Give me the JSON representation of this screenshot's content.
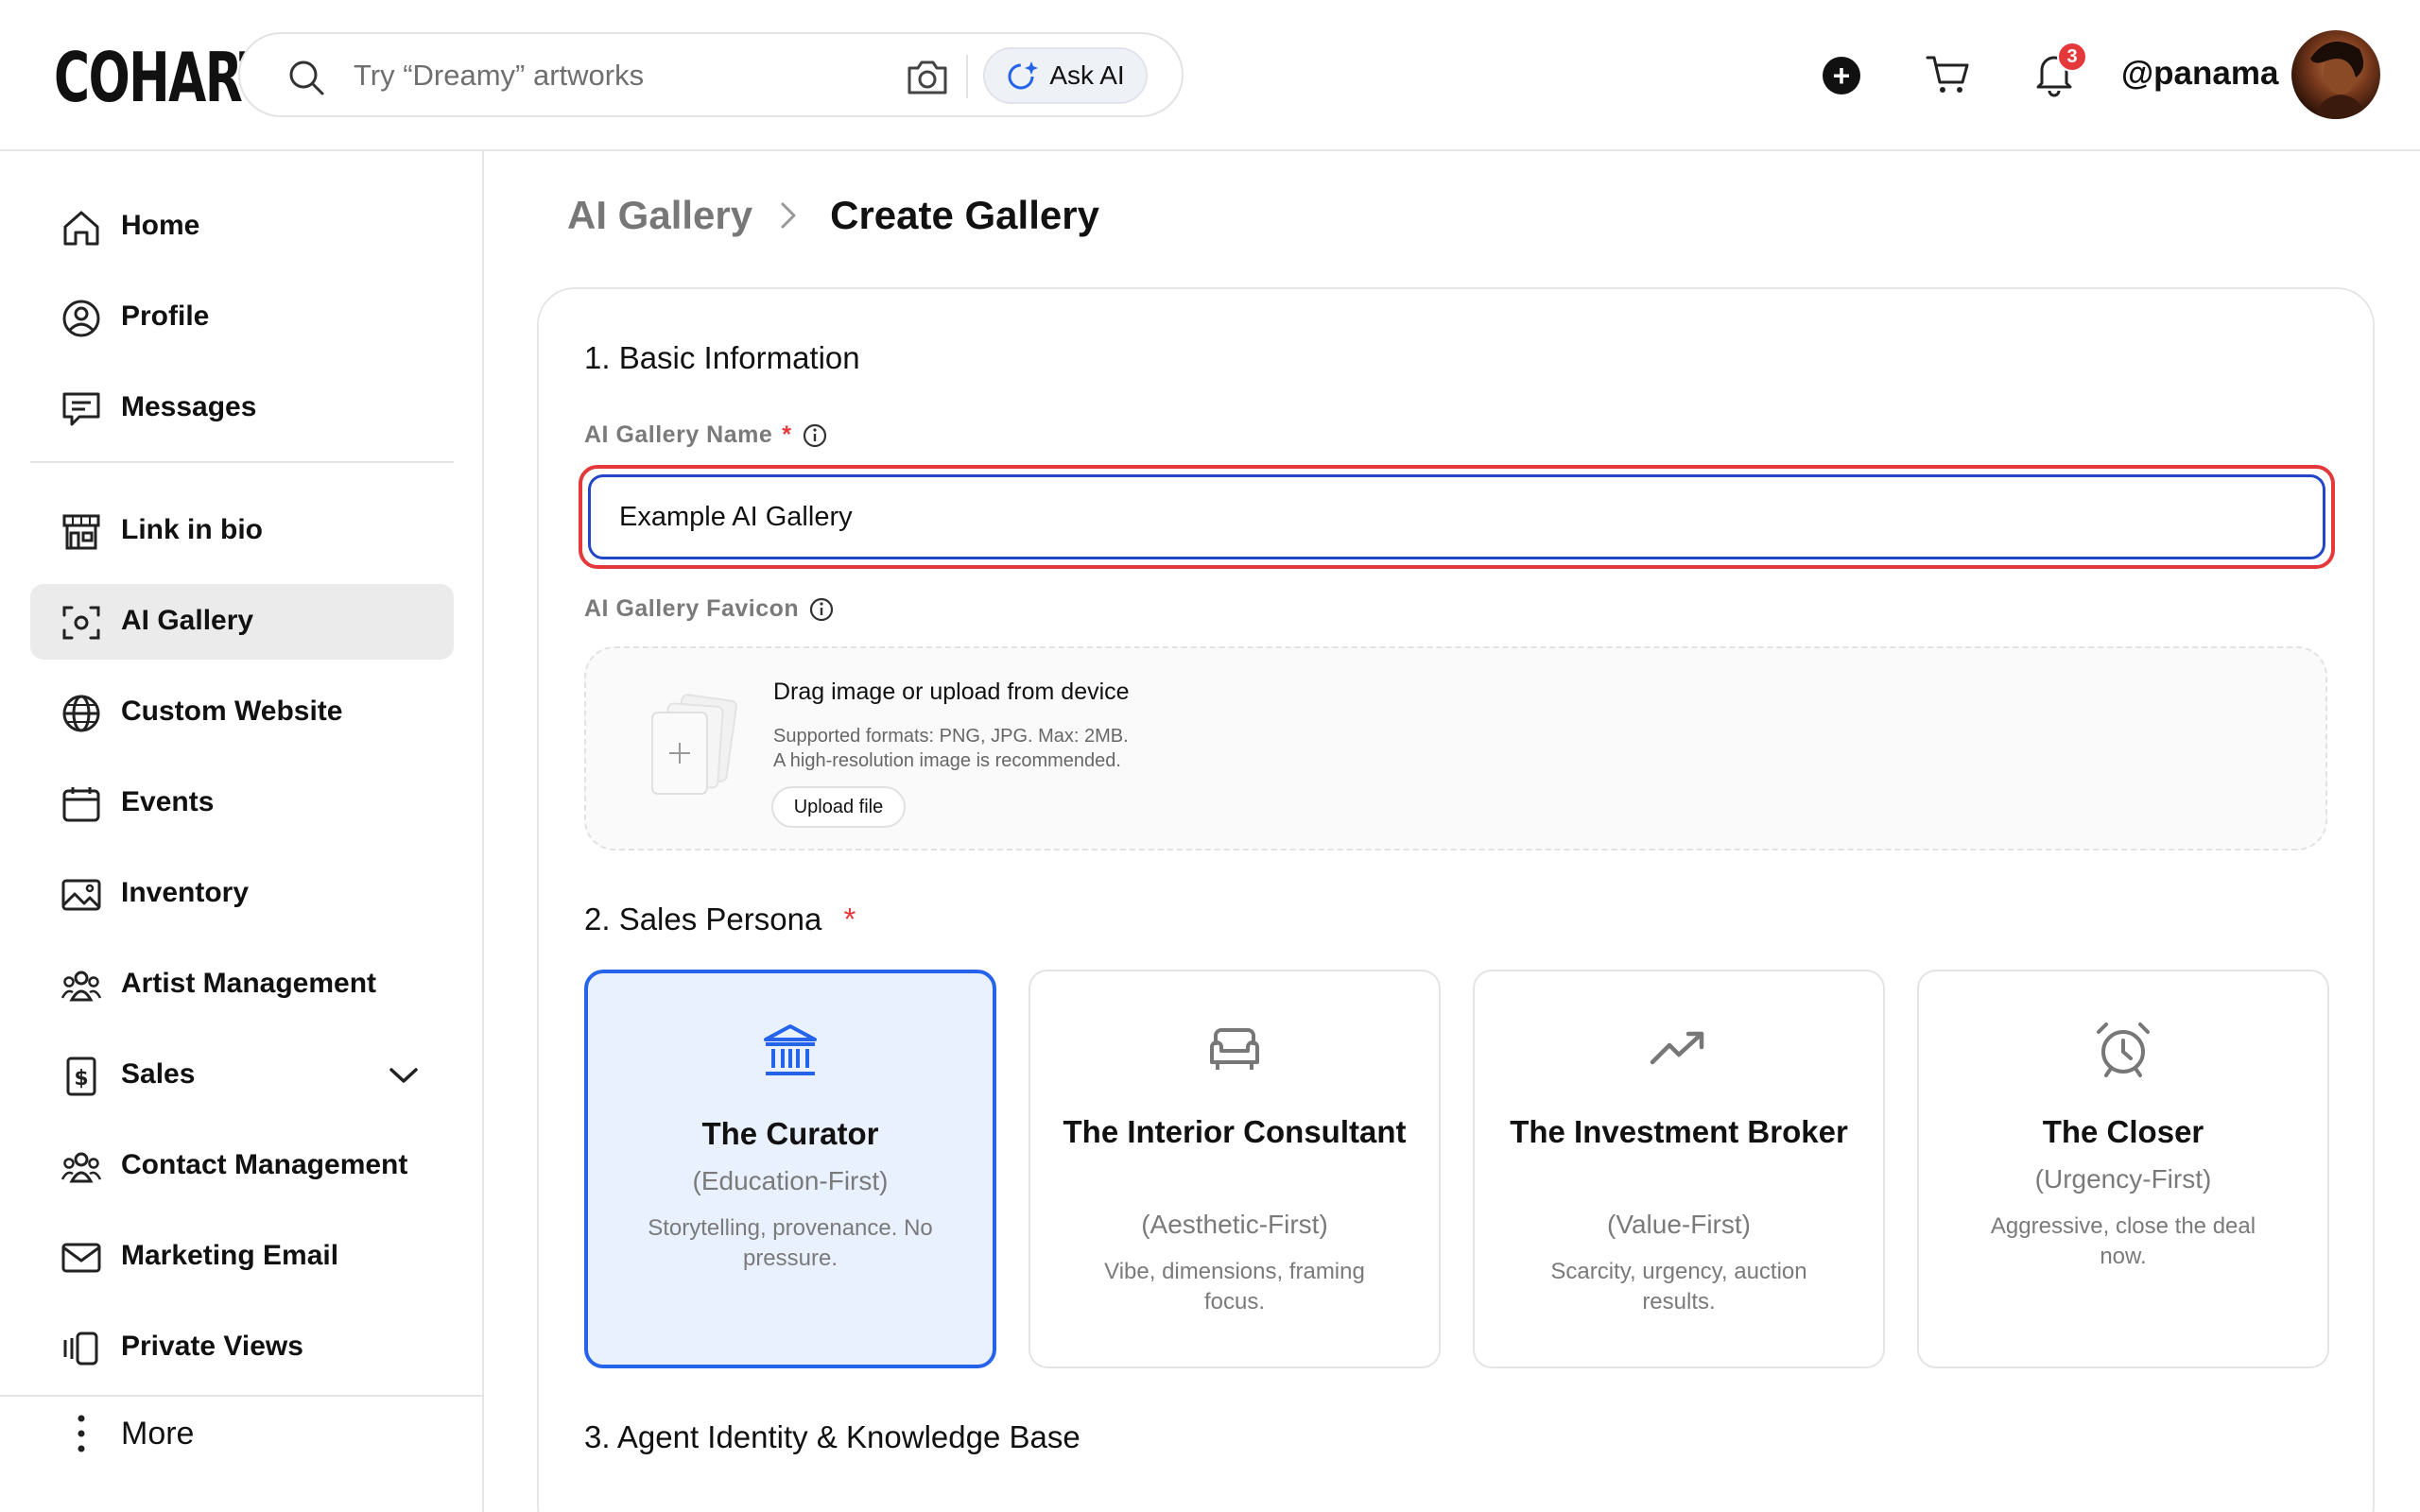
{
  "header": {
    "logo": "COHART",
    "search_placeholder": "Try “Dreamy” artworks",
    "ask_ai_label": "Ask AI",
    "notification_count": "3",
    "username": "@panama"
  },
  "sidebar": {
    "items": [
      {
        "label": "Home"
      },
      {
        "label": "Profile"
      },
      {
        "label": "Messages"
      },
      {
        "label": "Link in bio"
      },
      {
        "label": "AI Gallery"
      },
      {
        "label": "Custom Website"
      },
      {
        "label": "Events"
      },
      {
        "label": "Inventory"
      },
      {
        "label": "Artist Management"
      },
      {
        "label": "Sales"
      },
      {
        "label": "Contact Management"
      },
      {
        "label": "Marketing Email"
      },
      {
        "label": "Private Views"
      }
    ],
    "more_label": "More"
  },
  "breadcrumb": {
    "parent": "AI Gallery",
    "current": "Create Gallery"
  },
  "form": {
    "section1_title": "1. Basic Information",
    "name_label": "AI Gallery Name",
    "name_value": "Example AI Gallery",
    "favicon_label": "AI Gallery Favicon",
    "dropzone": {
      "title": "Drag image or upload from device",
      "formats": "Supported formats: PNG, JPG. Max: 2MB.",
      "recommendation": "A high-resolution image is recommended.",
      "upload_label": "Upload file"
    },
    "section2_title": "2. Sales Persona",
    "required_mark": "*",
    "personas": [
      {
        "name": "The Curator",
        "tag": "(Education-First)",
        "desc": "Storytelling, provenance. No pressure.",
        "icon": "museum-icon"
      },
      {
        "name": "The Interior Consultant",
        "tag": "(Aesthetic-First)",
        "desc": "Vibe, dimensions, framing focus.",
        "icon": "sofa-icon"
      },
      {
        "name": "The Investment Broker",
        "tag": "(Value-First)",
        "desc": "Scarcity, urgency, auction results.",
        "icon": "trending-up-icon"
      },
      {
        "name": "The Closer",
        "tag": "(Urgency-First)",
        "desc": "Aggressive, close the deal now.",
        "icon": "alarm-clock-icon"
      }
    ],
    "selected_persona": "The Curator",
    "section3_title": "3. Agent Identity & Knowledge Base"
  },
  "colors": {
    "accent_blue": "#2563eb",
    "selected_bg": "#eaf1fe",
    "error_red": "#e5383b",
    "active_nav_bg": "#ebebeb"
  }
}
